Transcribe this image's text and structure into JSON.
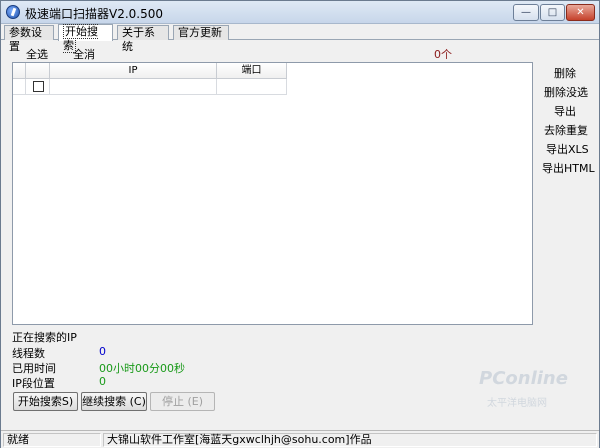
{
  "window": {
    "title": "极速端口扫描器V2.0.500",
    "controls": {
      "minimize": "—",
      "maximize": "□",
      "close": "✕"
    }
  },
  "tabs": [
    {
      "label": "参数设置",
      "active": false
    },
    {
      "label": "开始搜索",
      "active": true
    },
    {
      "label": "关于系统",
      "active": false
    },
    {
      "label": "官方更新",
      "active": false
    }
  ],
  "toolbar": {
    "select_all": "全选",
    "deselect_all": "全消",
    "count": "0个"
  },
  "table": {
    "columns": [
      "",
      "IP",
      "端口"
    ],
    "rows": [
      {
        "checked": false,
        "ip": "",
        "port": ""
      }
    ]
  },
  "actions": [
    "删除",
    "删除没选",
    "导出",
    "去除重复",
    "导出XLS",
    "导出HTML"
  ],
  "status": {
    "searching_ip_label": "正在搜索的IP",
    "threads_label": "线程数",
    "threads_value": "0",
    "elapsed_label": "已用时间",
    "elapsed_value": "00小时00分00秒",
    "ip_pos_label": "IP段位置",
    "ip_pos_value": "0"
  },
  "buttons": {
    "start": "开始搜索S)",
    "continue": "继续搜索 (C)",
    "stop": "停止 (E)"
  },
  "watermark": {
    "logo": "PConline",
    "sub": "太平洋电脑网"
  },
  "statusbar": {
    "state": "就绪",
    "credits": "大锦山软件工作室[海蓝天gxwclhjh@sohu.com]作品"
  },
  "colors": {
    "count": "#8b1a1a",
    "threads_value": "#0000cc",
    "elapsed_value": "#1a9a1a",
    "ip_pos_value": "#1a9a1a"
  }
}
